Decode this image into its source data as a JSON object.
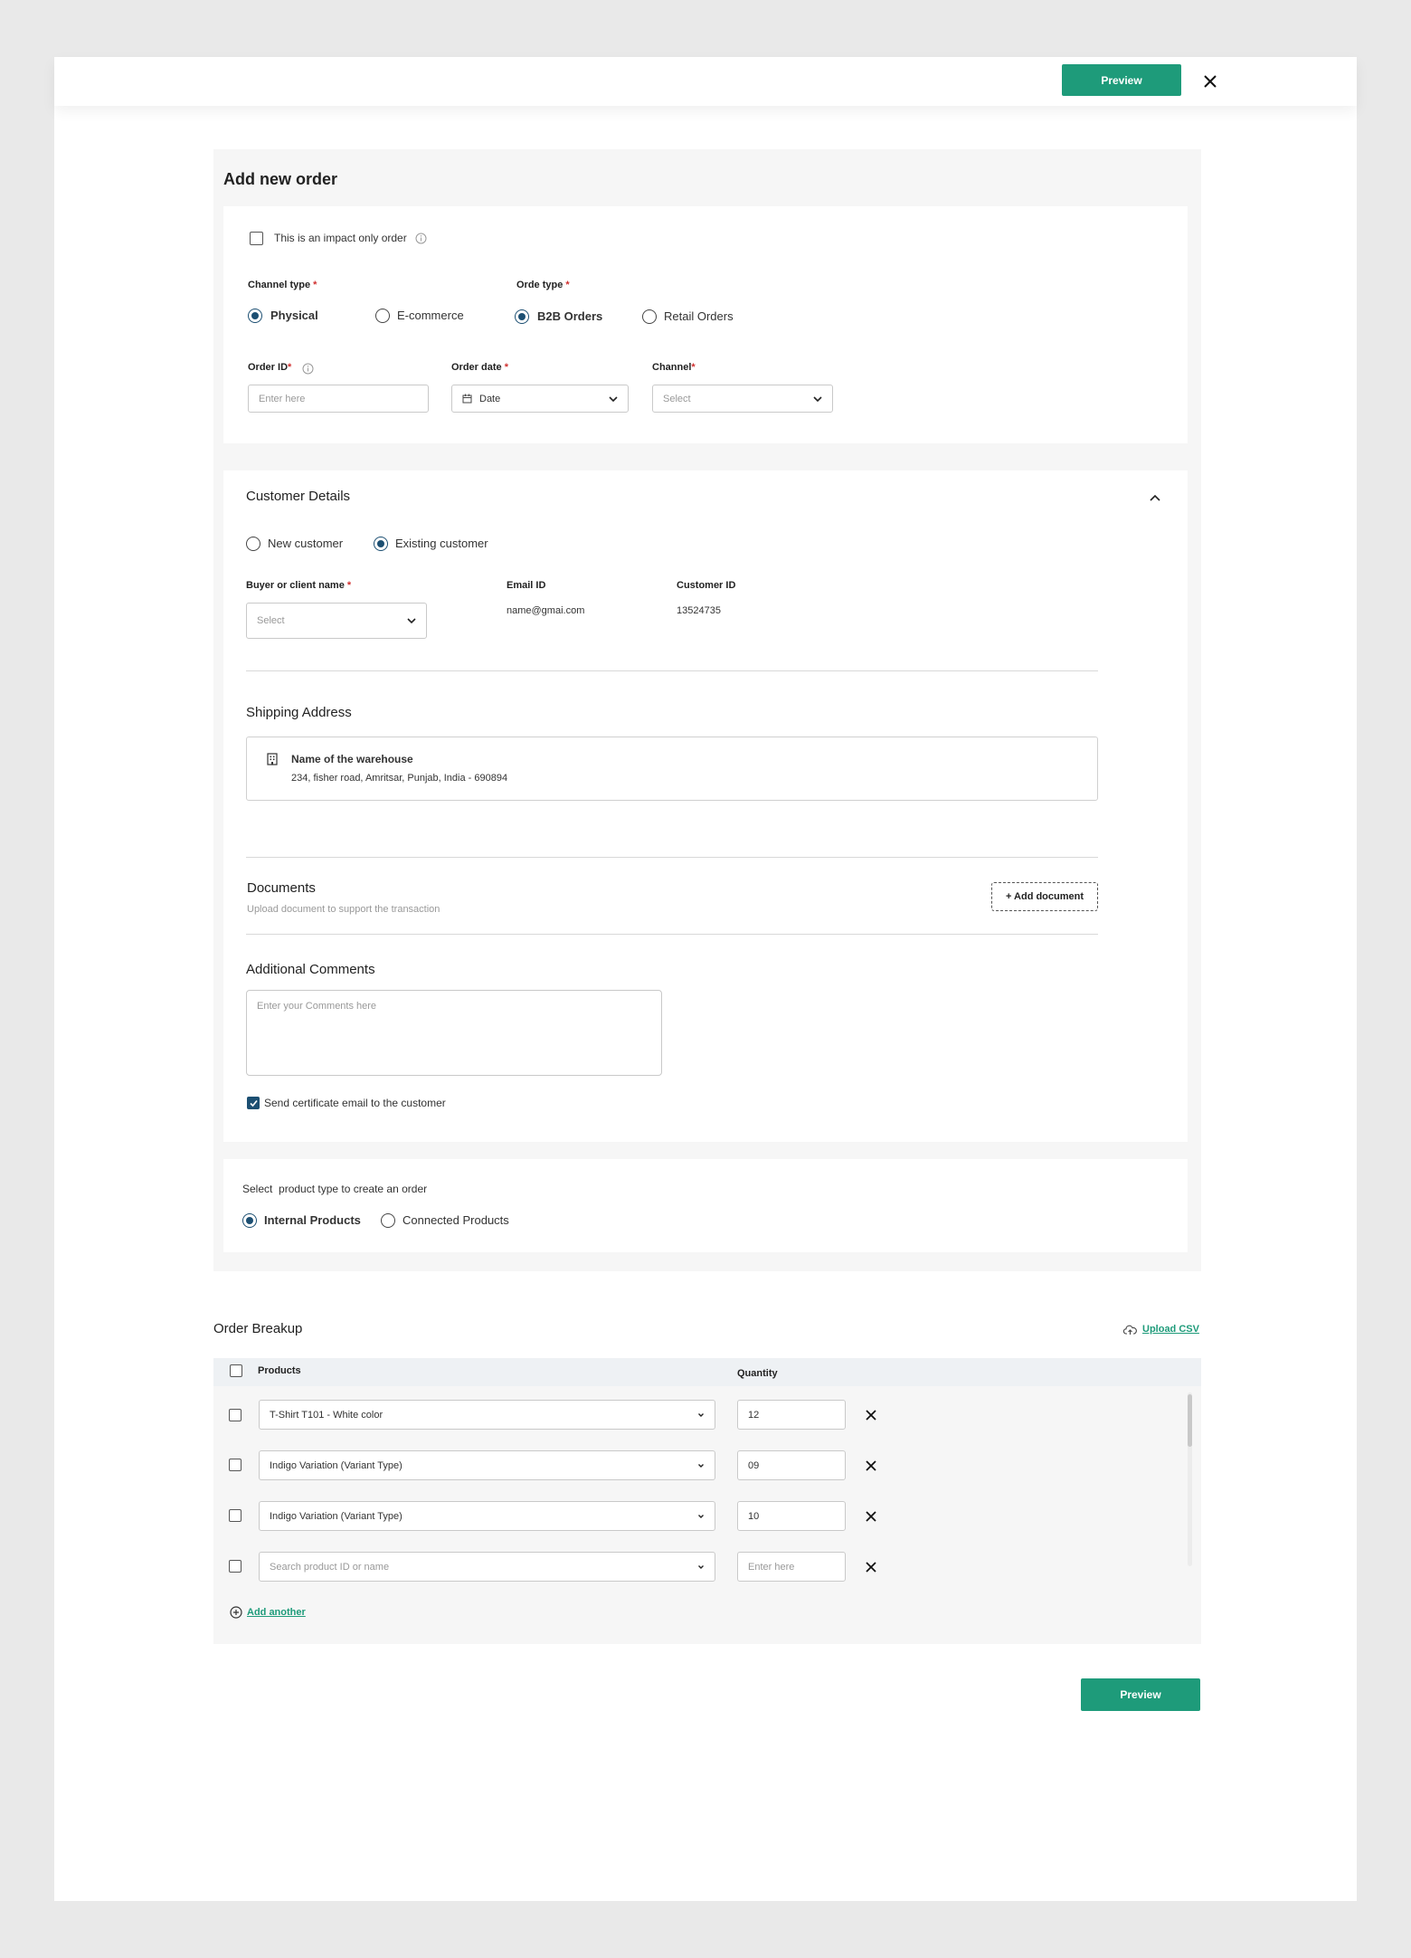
{
  "header": {
    "preview_label": "Preview"
  },
  "form": {
    "title": "Add new order",
    "impact_only_label": "This is an impact only order",
    "channel_type": {
      "label": "Channel type",
      "required": "*",
      "options": [
        "Physical",
        "E-commerce"
      ],
      "selected": "Physical"
    },
    "order_type": {
      "label": "Orde type",
      "required": "*",
      "options": [
        "B2B Orders",
        "Retail Orders"
      ],
      "selected": "B2B Orders"
    },
    "order_id": {
      "label": "Order ID",
      "required": "*",
      "placeholder": "Enter here"
    },
    "order_date": {
      "label": "Order date",
      "required": "*",
      "value": "Date"
    },
    "channel": {
      "label": "Channel",
      "required": "*",
      "placeholder": "Select"
    }
  },
  "customer": {
    "title": "Customer Details",
    "options": [
      "New customer",
      "Existing customer"
    ],
    "selected": "Existing customer",
    "buyer_label": "Buyer or client name",
    "buyer_required": "*",
    "buyer_placeholder": "Select",
    "email_label": "Email ID",
    "email_value": "name@gmai.com",
    "customer_id_label": "Customer ID",
    "customer_id_value": "13524735"
  },
  "shipping": {
    "title": "Shipping Address",
    "warehouse_name": "Name of the warehouse",
    "address": "234, fisher road, Amritsar, Punjab, India - 690894"
  },
  "documents": {
    "title": "Documents",
    "subtitle": "Upload document to support the transaction",
    "add_label": "+ Add document"
  },
  "comments": {
    "title": "Additional Comments",
    "placeholder": "Enter your Comments here",
    "send_email_label": "Send certificate email to the customer",
    "send_email_checked": true
  },
  "product_type": {
    "prompt": "Select  product type to create an order",
    "options": [
      "Internal Products",
      "Connected Products"
    ],
    "selected": "Internal Products"
  },
  "order_breakup": {
    "title": "Order Breakup",
    "upload_csv": "Upload CSV",
    "col_products": "Products",
    "col_quantity": "Quantity",
    "rows": [
      {
        "product": "T-Shirt T101 - White color",
        "quantity": "12"
      },
      {
        "product": "Indigo Variation (Variant Type)",
        "quantity": "09"
      },
      {
        "product": "Indigo Variation (Variant Type)",
        "quantity": "10"
      },
      {
        "product_placeholder": "Search product ID or name",
        "quantity_placeholder": "Enter here"
      }
    ],
    "add_another": "Add another"
  },
  "footer": {
    "preview_label": "Preview"
  },
  "colors": {
    "accent": "#1e9b7a",
    "radio_selected": "#1c4f72",
    "required": "#d0302f"
  }
}
